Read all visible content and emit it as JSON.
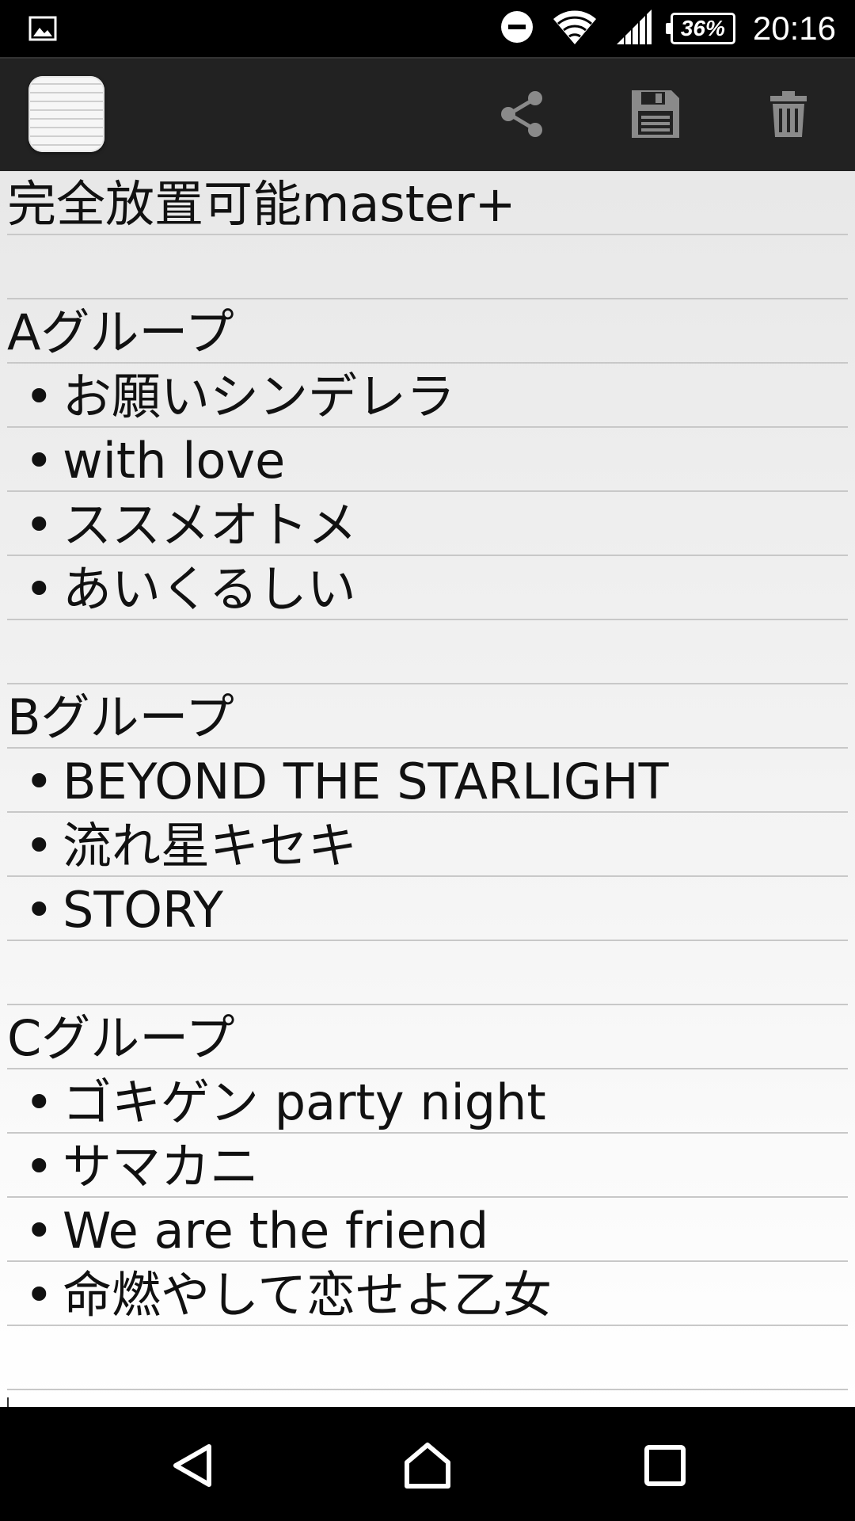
{
  "status_bar": {
    "battery_level": "36%",
    "time": "20:16",
    "icons": [
      "gallery-icon",
      "do-not-disturb-icon",
      "wifi-icon",
      "signal-icon",
      "battery-icon"
    ]
  },
  "app_bar": {
    "logo_icon": "notepad-icon",
    "actions": [
      "share-icon",
      "save-icon",
      "delete-icon"
    ]
  },
  "memo": {
    "bullet": "•",
    "lines": [
      {
        "type": "text",
        "text": "完全放置可能master+"
      },
      {
        "type": "text",
        "text": ""
      },
      {
        "type": "text",
        "text": "Aグループ"
      },
      {
        "type": "item",
        "text": "お願いシンデレラ"
      },
      {
        "type": "item",
        "text": "with love"
      },
      {
        "type": "item",
        "text": "ススメオトメ"
      },
      {
        "type": "item",
        "text": "あいくるしい"
      },
      {
        "type": "text",
        "text": ""
      },
      {
        "type": "text",
        "text": "Bグループ"
      },
      {
        "type": "item",
        "text": "BEYOND THE STARLIGHT"
      },
      {
        "type": "item",
        "text": "流れ星キセキ"
      },
      {
        "type": "item",
        "text": "STORY"
      },
      {
        "type": "text",
        "text": ""
      },
      {
        "type": "text",
        "text": "Cグループ"
      },
      {
        "type": "item",
        "text": "ゴキゲン party night"
      },
      {
        "type": "item",
        "text": "サマカニ"
      },
      {
        "type": "item",
        "text": "We are the friend"
      },
      {
        "type": "item",
        "text": "命燃やして恋せよ乙女"
      },
      {
        "type": "text",
        "text": ""
      }
    ]
  },
  "nav_bar": {
    "buttons": [
      "back-icon",
      "home-icon",
      "recent-apps-icon"
    ]
  },
  "colors": {
    "app_bar": "#222222",
    "icon_gray": "#8a8a8a",
    "text": "#111111",
    "rule_line": "#c8c8c8"
  }
}
